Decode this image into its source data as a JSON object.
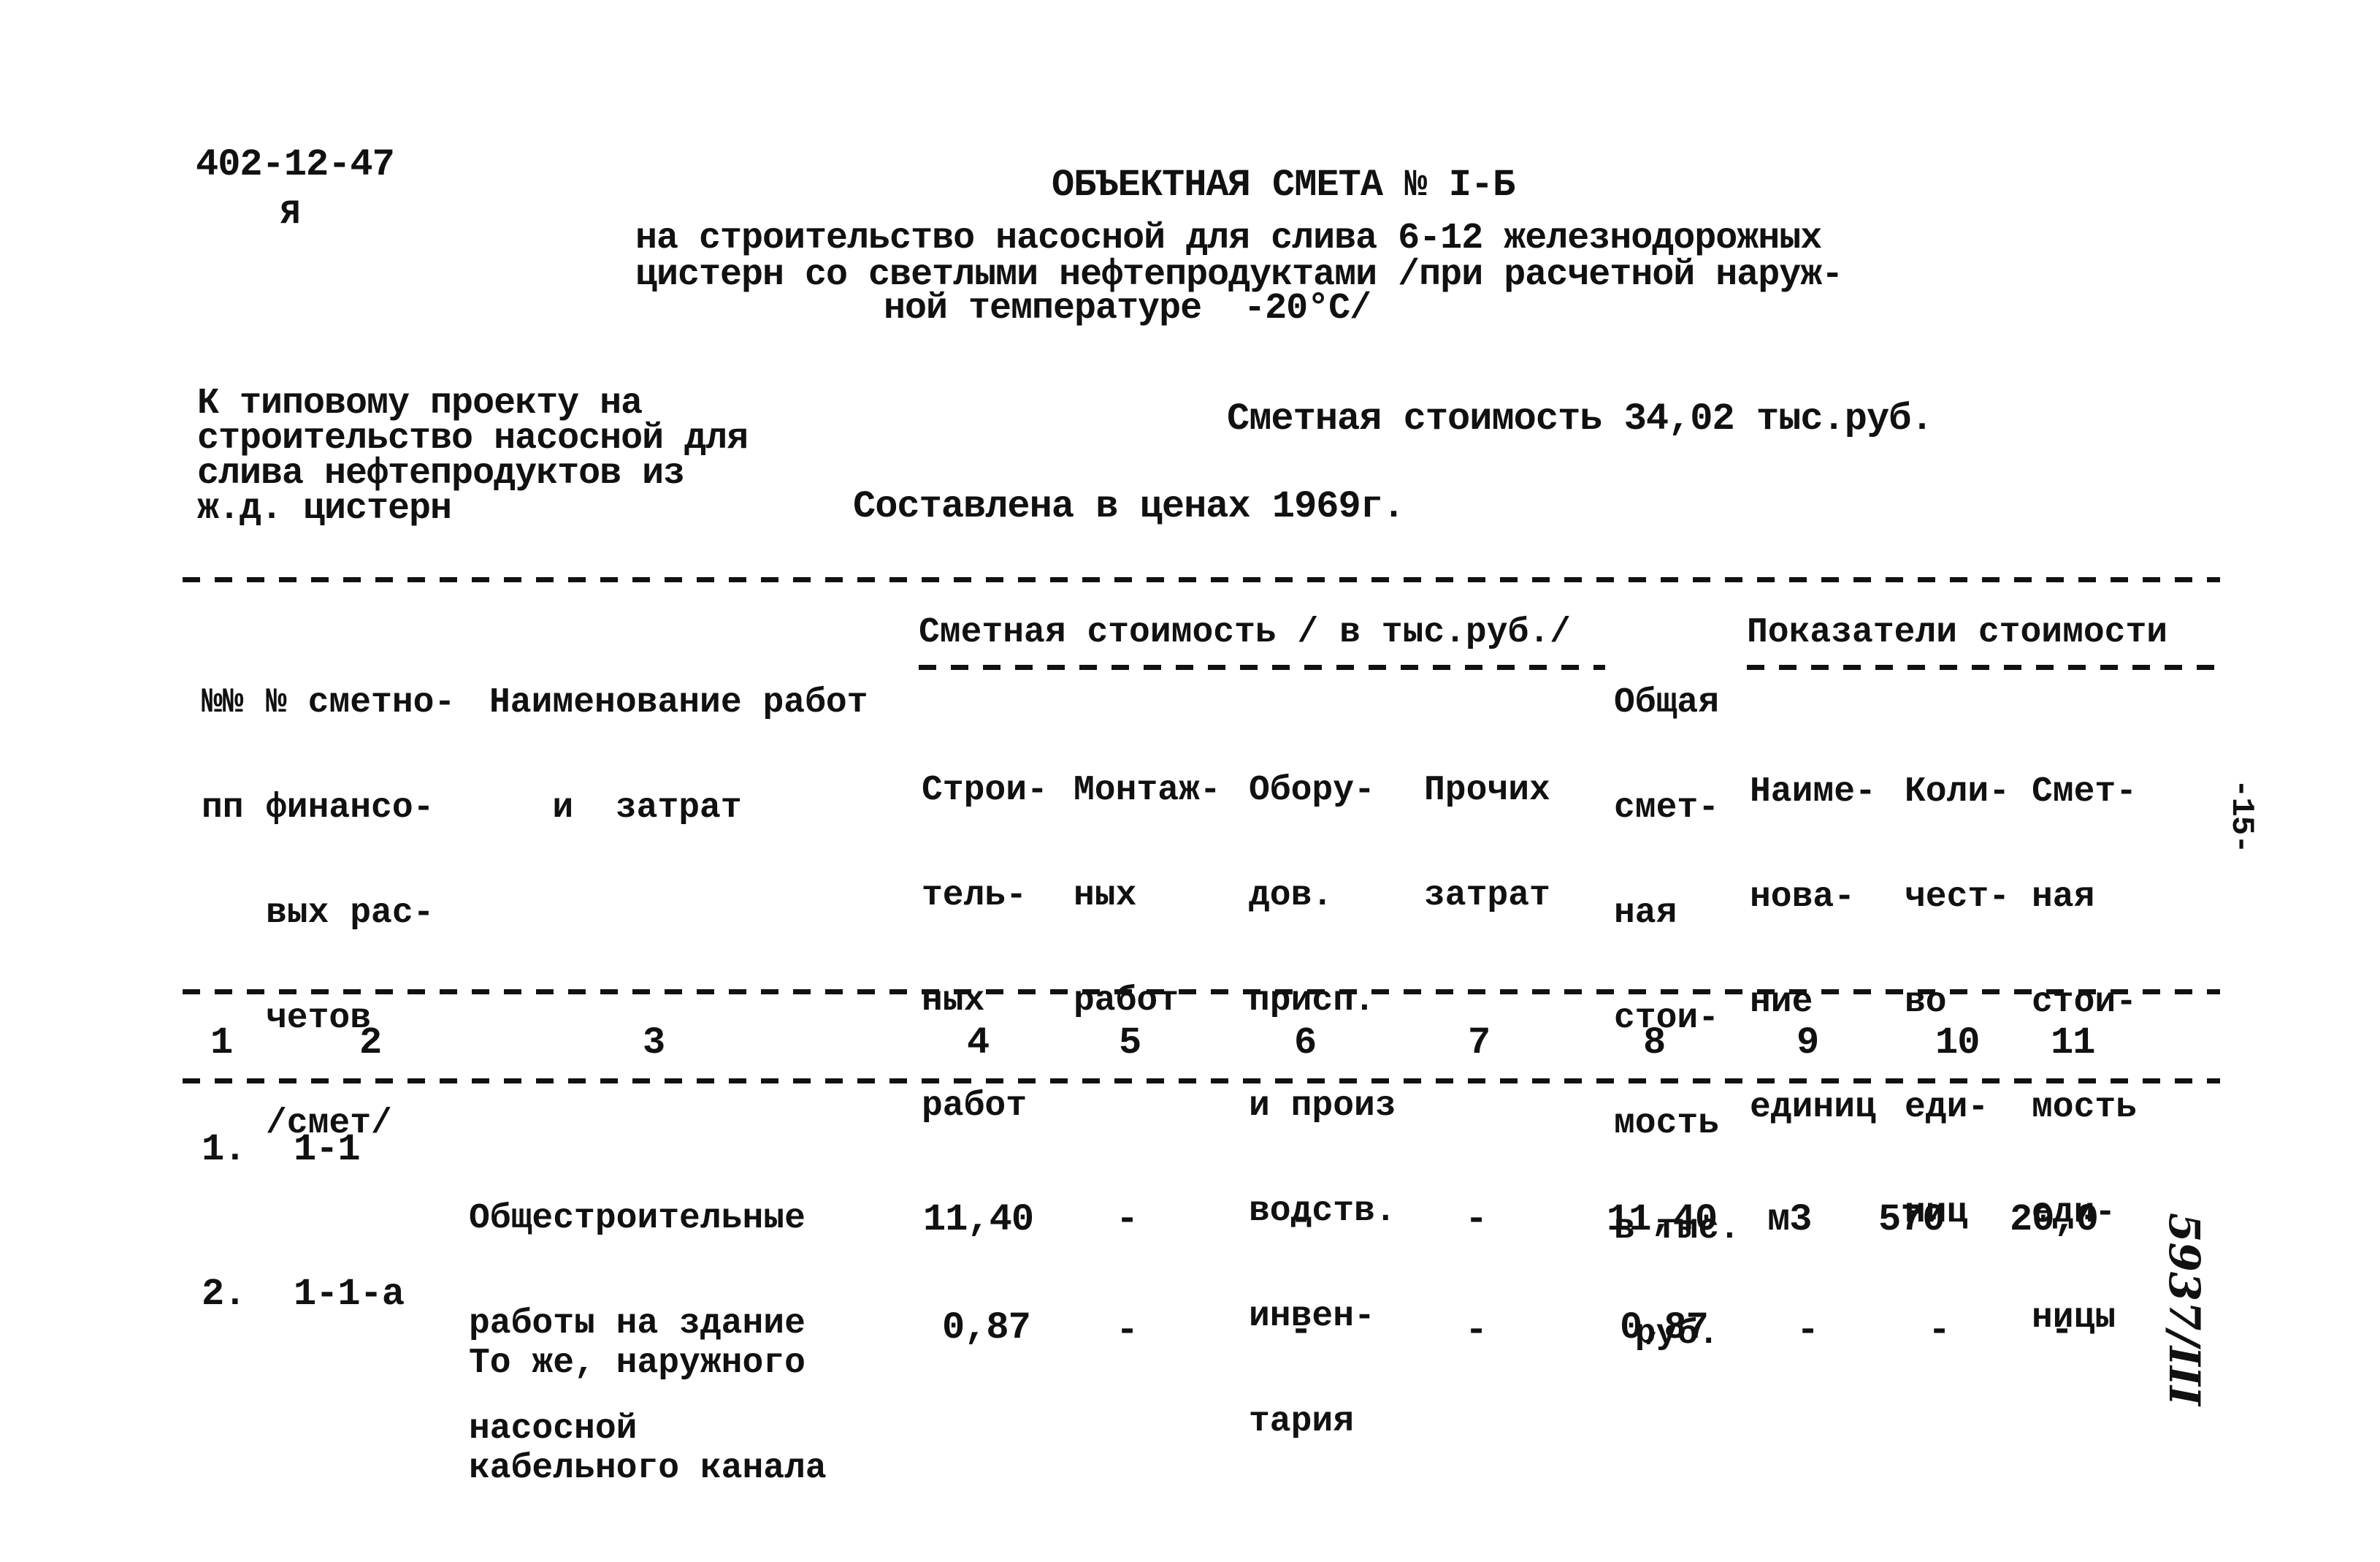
{
  "doc_code": "402-12-47",
  "doc_mark": "Я",
  "title": "ОБЪЕКТНАЯ СМЕТА № I-Б",
  "subtitle_lines": [
    "на строительство насосной для слива 6-12 железнодорожных",
    "цистерн со светлыми нефтепродуктами /при расчетной наруж-",
    "ной температуре  -20°С/"
  ],
  "project_lines": [
    "К типовому проекту на",
    "строительство насосной для",
    "слива нефтепродуктов из",
    "ж.д. цистерн"
  ],
  "estimated_cost": "Сметная стоимость 34,02 тыс.руб.",
  "prices_note": "Составлена в ценах 1969г.",
  "page_number": "-15-",
  "archive_mark": "5937/III",
  "table": {
    "headers": {
      "col1": [
        "№№",
        "пп"
      ],
      "col2": [
        "№ сметно-",
        "финансо-",
        "вых рас-",
        "четов",
        "/смет/"
      ],
      "col3": [
        "Наименование работ",
        "   и  затрат"
      ],
      "cost_group": "Сметная стоимость / в тыс.руб./",
      "col4": [
        "Строи-",
        "тель-",
        "ных",
        "работ"
      ],
      "col5": [
        "Монтаж-",
        "ных",
        "работ"
      ],
      "col6": [
        "Обору-",
        "дов.",
        "присп.",
        "и произ",
        "водств.",
        "инвен-",
        "тария"
      ],
      "col7": [
        "Прочих",
        "затрат"
      ],
      "col8": [
        "Общая",
        "смет-",
        "ная",
        "стои-",
        "мость",
        "в тыс.",
        " руб."
      ],
      "indicators_group": "Показатели стоимости",
      "col9": [
        "Наиме-",
        "нова-",
        "ние",
        "единиц"
      ],
      "col10": [
        "Коли-",
        "чест-",
        "во",
        "еди-",
        "ниц"
      ],
      "col11": [
        "Смет-",
        "ная",
        "стои-",
        "мость",
        "еди-",
        "ницы"
      ]
    },
    "column_numbers": [
      "1",
      "2",
      "3",
      "4",
      "5",
      "6",
      "7",
      "8",
      "9",
      "10",
      "11"
    ],
    "rows": [
      {
        "num": "1.",
        "estimate": "1-1",
        "name": [
          "Общестроительные",
          "работы на здание",
          "насосной"
        ],
        "construction": "11,40",
        "installation": "-",
        "equipment": "-",
        "other": "-",
        "total": "11,40",
        "unit": "м3",
        "quantity": "570",
        "unit_cost": "20,0"
      },
      {
        "num": "2.",
        "estimate": "1-1-а",
        "name": [
          "То же, наружного",
          "кабельного канала"
        ],
        "construction": "0,87",
        "installation": "-",
        "equipment": "-",
        "other": "-",
        "total": "0,87",
        "unit": "-",
        "quantity": "-",
        "unit_cost": "-"
      }
    ]
  }
}
